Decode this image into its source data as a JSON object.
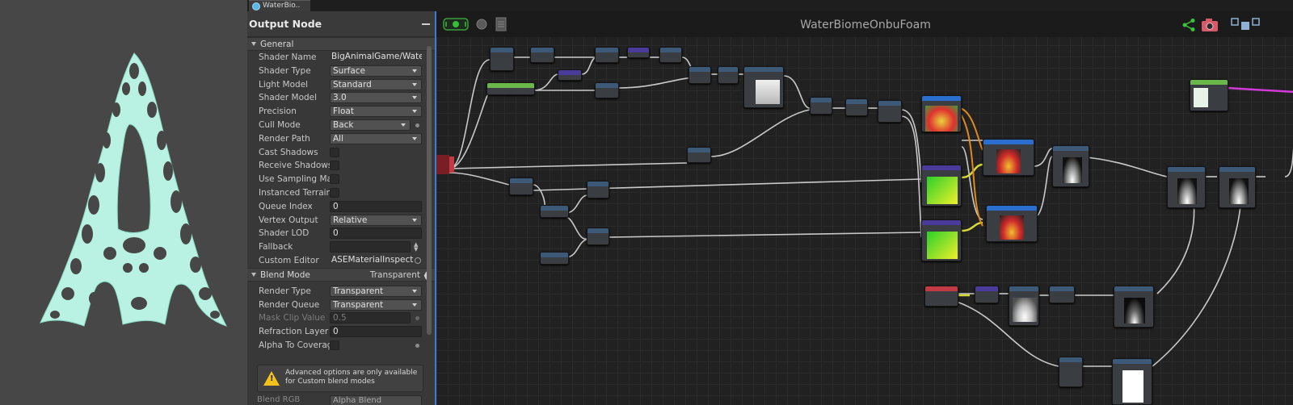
{
  "tab": {
    "label": "WaterBio.."
  },
  "inspector": {
    "title": "Output Node",
    "general_header": "General",
    "rows": [
      {
        "label": "Shader Name",
        "value": "BigAnimalGame/Waterl",
        "kind": "text"
      },
      {
        "label": "Shader Type",
        "value": "Surface",
        "kind": "dropdown"
      },
      {
        "label": "Light Model",
        "value": "Standard",
        "kind": "dropdown"
      },
      {
        "label": "Shader Model",
        "value": "3.0",
        "kind": "dropdown"
      },
      {
        "label": "Precision",
        "value": "Float",
        "kind": "dropdown"
      },
      {
        "label": "Cull Mode",
        "value": "Back",
        "kind": "dropdown"
      },
      {
        "label": "Render Path",
        "value": "All",
        "kind": "dropdown"
      },
      {
        "label": "Cast Shadows",
        "value": "",
        "kind": "checkbox"
      },
      {
        "label": "Receive Shadows",
        "value": "",
        "kind": "checkbox"
      },
      {
        "label": "Use Sampling Mac",
        "value": "",
        "kind": "checkbox"
      },
      {
        "label": "Instanced Terrain",
        "value": "",
        "kind": "checkbox"
      },
      {
        "label": "Queue Index",
        "value": "0",
        "kind": "text"
      },
      {
        "label": "Vertex Output",
        "value": "Relative",
        "kind": "dropdown"
      },
      {
        "label": "Shader LOD",
        "value": "0",
        "kind": "text"
      },
      {
        "label": "Fallback",
        "value": "",
        "kind": "text"
      },
      {
        "label": "Custom Editor",
        "value": "ASEMaterialInspect",
        "kind": "text"
      }
    ],
    "blend_header": "Blend Mode",
    "blend_value": "Transparent",
    "blend_rows": [
      {
        "label": "Render Type",
        "value": "Transparent",
        "kind": "dropdown"
      },
      {
        "label": "Render Queue",
        "value": "Transparent",
        "kind": "dropdown"
      },
      {
        "label": "Mask Clip Value",
        "value": "0.5",
        "kind": "text"
      },
      {
        "label": "Refraction Layer",
        "value": "0",
        "kind": "text"
      },
      {
        "label": "Alpha To Coverag",
        "value": "",
        "kind": "checkbox"
      }
    ],
    "warning": "Advanced options are only available for Custom blend modes",
    "bottom_label": "Blend RGB",
    "bottom_value": "Alpha Blend"
  },
  "canvas": {
    "title": "WaterBiomeOnbuFoam",
    "colors": {
      "accent_blue": "#3f7bd6",
      "wire": "#c9c9c9",
      "wire_yellow": "#d8d83a",
      "wire_orange": "#e08a1e",
      "wire_magenta": "#d23ad8"
    },
    "icons": [
      "live-toggle-icon",
      "circle-icon",
      "document-icon",
      "share-icon",
      "camera-icon",
      "takeout-icon"
    ]
  }
}
